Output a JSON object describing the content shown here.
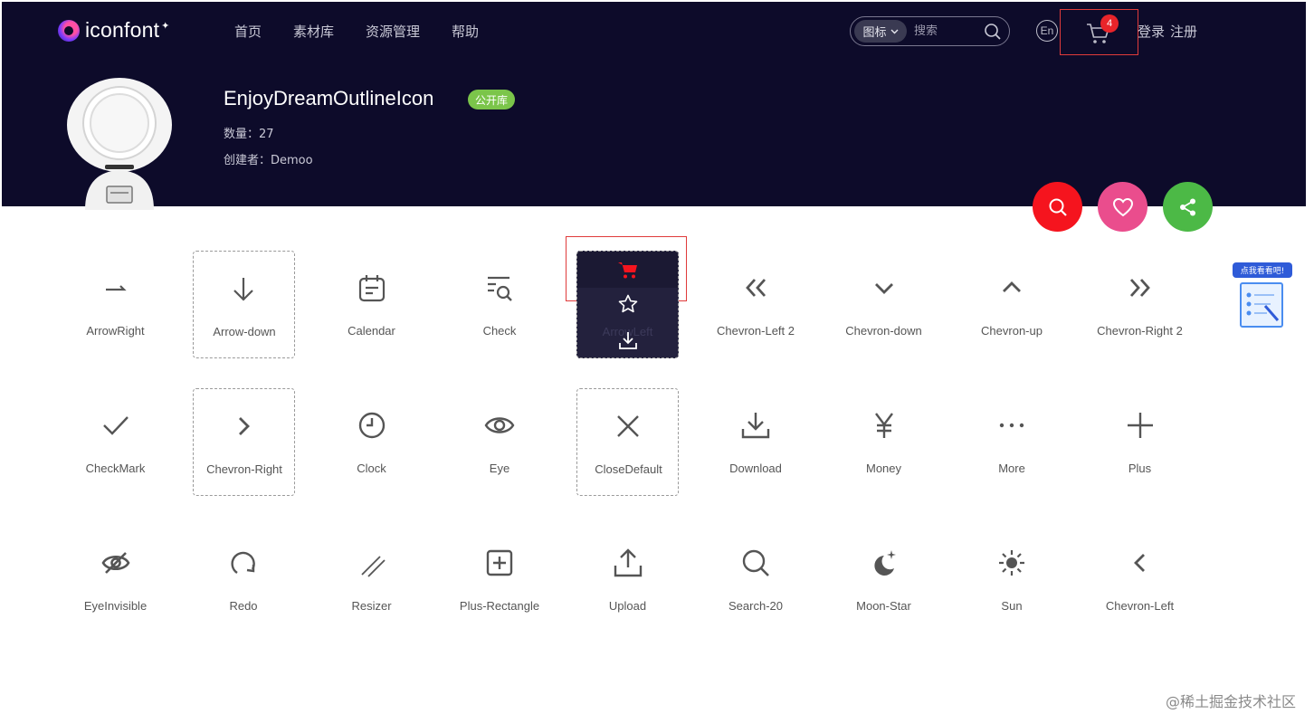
{
  "header": {
    "logo_text": "iconfont",
    "nav": [
      "首页",
      "素材库",
      "资源管理",
      "帮助"
    ],
    "search": {
      "type_label": "图标",
      "placeholder": "搜索"
    },
    "lang": "En",
    "cart_count": "4",
    "auth": {
      "login": "登录",
      "register": "注册"
    }
  },
  "project": {
    "title": "EnjoyDreamOutlineIcon",
    "tag": "公开库",
    "count_label": "数量：27",
    "creator_label": "创建者：Demoo"
  },
  "icons": {
    "row1": [
      "ArrowRight",
      "Arrow-down",
      "Calendar",
      "Check",
      "ArrowLeft",
      "Chevron-Left 2",
      "Chevron-down",
      "Chevron-up",
      "Chevron-Right 2"
    ],
    "row2": [
      "CheckMark",
      "Chevron-Right",
      "Clock",
      "Eye",
      "CloseDefault",
      "Download",
      "Money",
      "More",
      "Plus"
    ],
    "row3": [
      "EyeInvisible",
      "Redo",
      "Resizer",
      "Plus-Rectangle",
      "Upload",
      "Search-20",
      "Moon-Star",
      "Sun",
      "Chevron-Left"
    ]
  },
  "side_widget": {
    "label": "点我看看吧!"
  },
  "watermark": "@稀土掘金技术社区",
  "colors": {
    "header_bg": "#0d0b2a",
    "accent_red": "#f5141e",
    "accent_pink": "#ea4d8d",
    "accent_green": "#4cb946",
    "tag_green": "#7bc54a"
  }
}
